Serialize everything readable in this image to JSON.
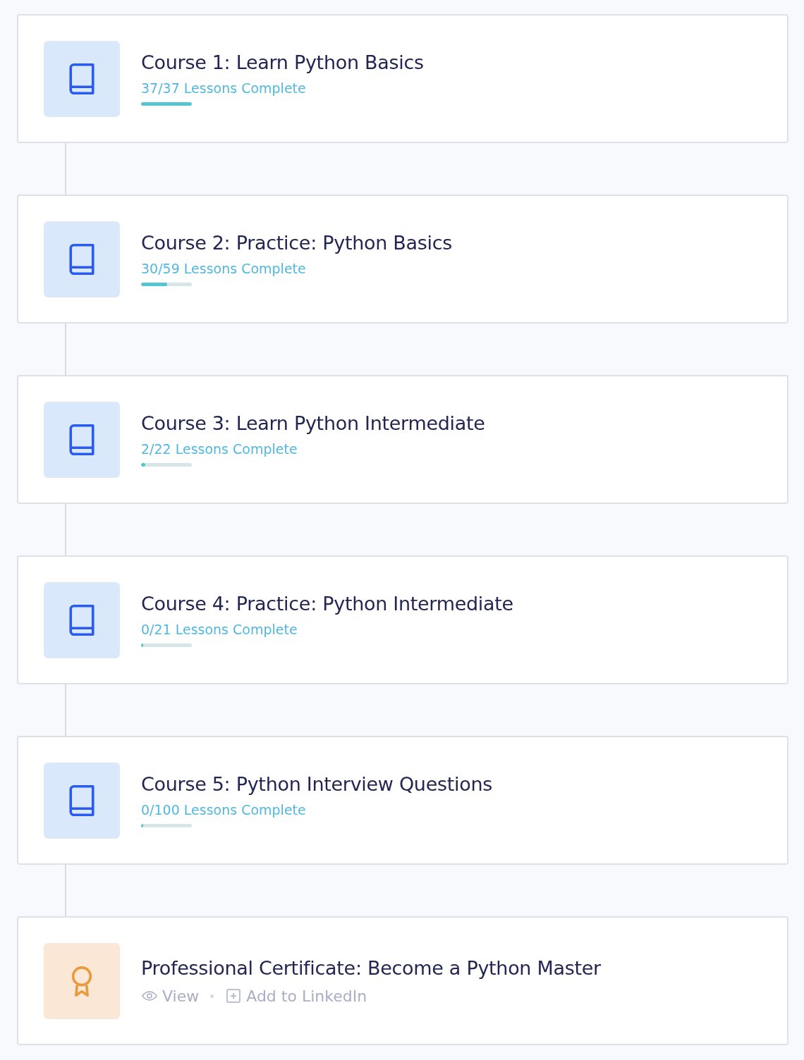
{
  "items": [
    {
      "kind": "course",
      "title": "Course 1: Learn Python Basics",
      "progress_text": "37/37 Lessons Complete",
      "level": 1
    },
    {
      "kind": "course",
      "title": "Course 2: Practice: Python Basics",
      "progress_text": "30/59 Lessons Complete",
      "level": 0.51
    },
    {
      "kind": "course",
      "title": "Course 3: Learn Python Intermediate",
      "progress_text": "2/22 Lessons Complete",
      "level": 0.09
    },
    {
      "kind": "course",
      "title": "Course 4: Practice: Python Intermediate",
      "progress_text": "0/21 Lessons Complete",
      "level": 0
    },
    {
      "kind": "course",
      "title": "Course 5: Python Interview Questions",
      "progress_text": "0/100 Lessons Complete",
      "level": 0
    },
    {
      "kind": "certificate",
      "title": "Professional Certificate: Become a Python Master",
      "actions": [
        {
          "kind": "view",
          "label": "View"
        },
        {
          "kind": "linkedin",
          "label": "Add to LinkedIn"
        }
      ]
    }
  ]
}
